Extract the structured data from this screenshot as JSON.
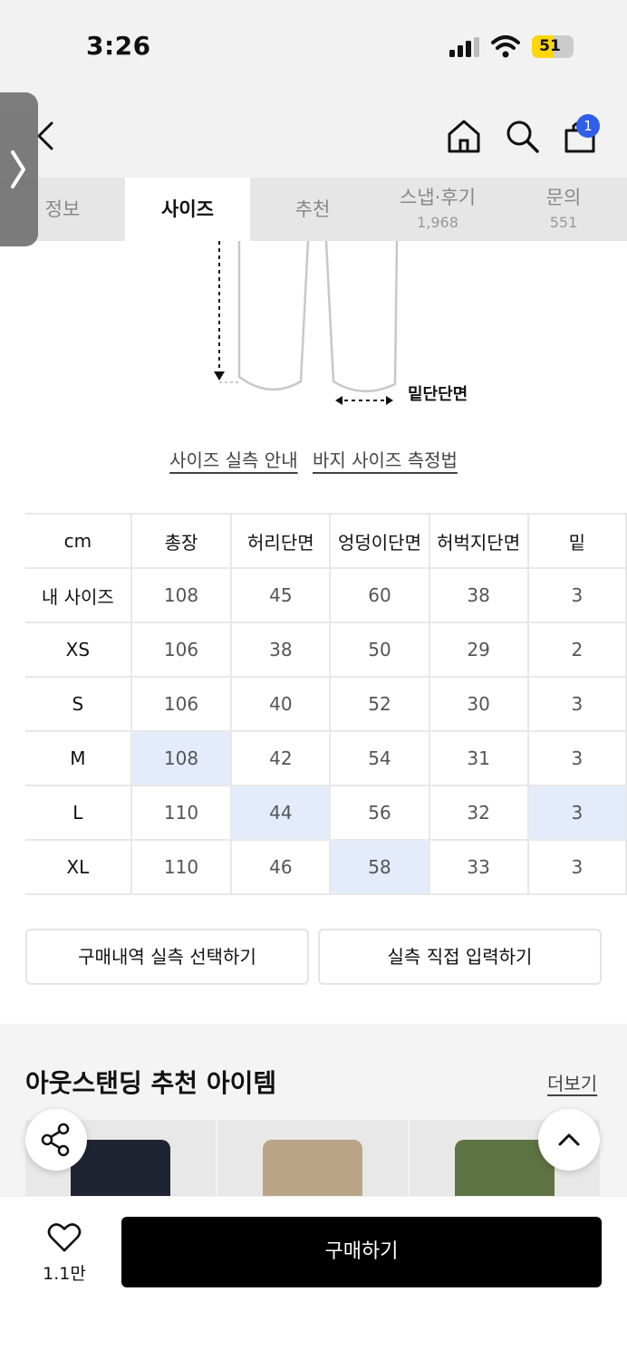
{
  "status_bar": {
    "time": "3:26",
    "battery": "51"
  },
  "header": {
    "cart_count": "1"
  },
  "tabs": [
    {
      "label": "정보",
      "sub": ""
    },
    {
      "label": "사이즈",
      "sub": ""
    },
    {
      "label": "추천",
      "sub": ""
    },
    {
      "label": "스냅·후기",
      "sub": "1,968"
    },
    {
      "label": "문의",
      "sub": "551"
    }
  ],
  "diagram": {
    "hem_label": "밑단단면"
  },
  "guide_links": {
    "actual_size_guide": "사이즈 실측 안내",
    "pants_measure": "바지 사이즈 측정법"
  },
  "size_table": {
    "headers": [
      "cm",
      "총장",
      "허리단면",
      "엉덩이단면",
      "허벅지단면",
      "밑"
    ],
    "rows": [
      {
        "size": "내 사이즈",
        "values": [
          "108",
          "45",
          "60",
          "38",
          "3"
        ]
      },
      {
        "size": "XS",
        "values": [
          "106",
          "38",
          "50",
          "29",
          "2"
        ]
      },
      {
        "size": "S",
        "values": [
          "106",
          "40",
          "52",
          "30",
          "3"
        ]
      },
      {
        "size": "M",
        "values": [
          "108",
          "42",
          "54",
          "31",
          "3"
        ]
      },
      {
        "size": "L",
        "values": [
          "110",
          "44",
          "56",
          "32",
          "3"
        ]
      },
      {
        "size": "XL",
        "values": [
          "110",
          "46",
          "58",
          "33",
          "3"
        ]
      }
    ]
  },
  "actions": {
    "select_purchase": "구매내역 실측 선택하기",
    "direct_input": "실측 직접 입력하기"
  },
  "recommend": {
    "title": "아웃스탠딩 추천 아이템",
    "more": "더보기"
  },
  "bottom_bar": {
    "like_count": "1.1만",
    "buy_label": "구매하기"
  },
  "colors": {
    "highlight": "#e4ecfb",
    "badge": "#2f5ee8",
    "buy_button": "#000000"
  }
}
